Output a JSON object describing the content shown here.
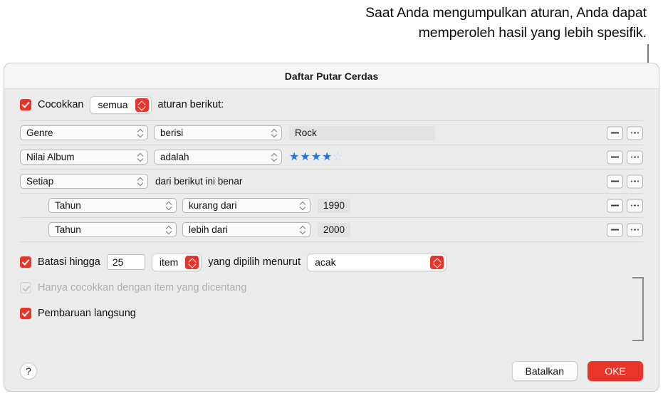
{
  "callout": {
    "line1": "Saat Anda mengumpulkan aturan, Anda dapat",
    "line2": "memperoleh hasil yang lebih spesifik."
  },
  "dialog": {
    "title": "Daftar Putar Cerdas"
  },
  "match": {
    "checked": true,
    "label": "Cocokkan",
    "selected": "semua",
    "suffix": "aturan berikut:"
  },
  "rules": [
    {
      "indent": 0,
      "criteria": "Genre",
      "operator": "berisi",
      "value_type": "text",
      "value": "Rock"
    },
    {
      "indent": 0,
      "criteria": "Nilai Album",
      "operator": "adalah",
      "value_type": "stars",
      "stars_filled": 4,
      "stars_total": 5
    },
    {
      "indent": 0,
      "criteria": "Setiap",
      "value_type": "text_label",
      "value": "dari berikut ini benar"
    },
    {
      "indent": 1,
      "criteria": "Tahun",
      "operator": "kurang dari",
      "value_type": "number",
      "value": "1990"
    },
    {
      "indent": 1,
      "criteria": "Tahun",
      "operator": "lebih dari",
      "value_type": "number",
      "value": "2000"
    }
  ],
  "row_buttons": {
    "remove": "minus-icon",
    "more": "ellipsis-icon"
  },
  "limit": {
    "checked": true,
    "label": "Batasi hingga",
    "amount": "25",
    "unit": "item",
    "mid_label": "yang dipilih menurut",
    "sort_by": "acak"
  },
  "match_checked_only": {
    "checked": true,
    "disabled": true,
    "label": "Hanya cocokkan dengan item yang dicentang"
  },
  "live_update": {
    "checked": true,
    "label": "Pembaruan langsung"
  },
  "footer": {
    "help": "?",
    "cancel": "Batalkan",
    "ok": "OKE"
  },
  "colors": {
    "accent": "#e8342a",
    "star_on": "#2474e0",
    "star_off": "#bcd2ef",
    "dialog_bg": "#ececec"
  }
}
